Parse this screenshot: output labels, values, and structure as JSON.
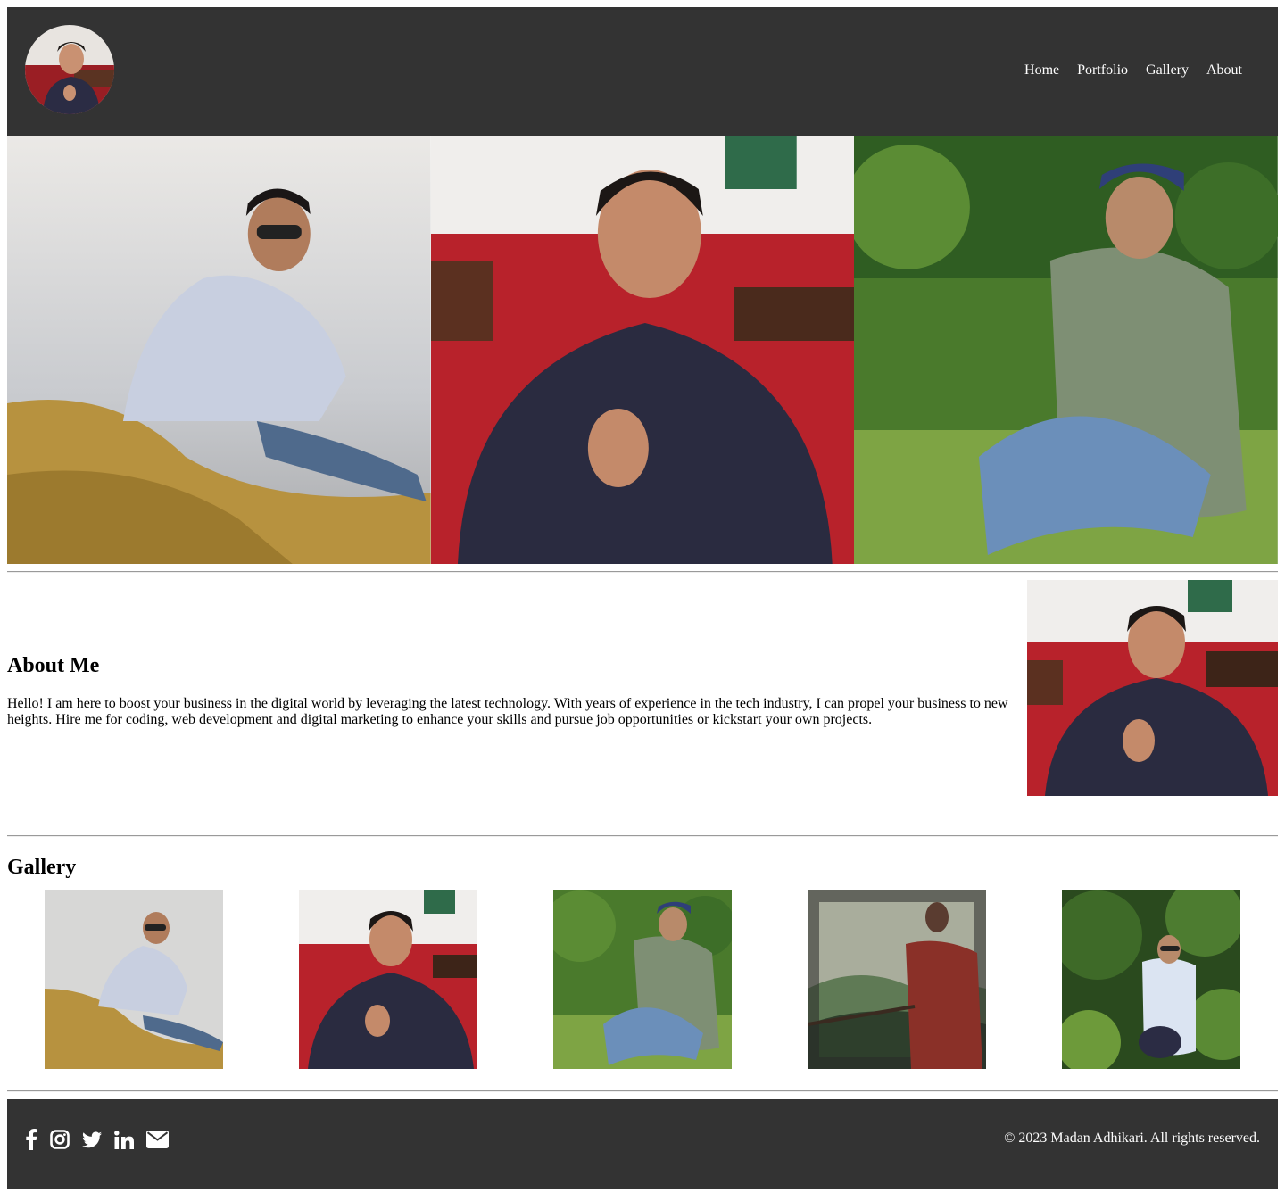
{
  "header": {
    "nav": [
      "Home",
      "Portfolio",
      "Gallery",
      "About"
    ]
  },
  "about": {
    "title": "About Me",
    "text": "Hello! I am here to boost your business in the digital world by leveraging the latest technology. With years of experience in the tech industry, I can propel your business to new heights. Hire me for coding, web development and digital marketing to enhance your skills and pursue job opportunities or kickstart your own projects."
  },
  "gallery": {
    "title": "Gallery"
  },
  "footer": {
    "social_icons": [
      "facebook-icon",
      "instagram-icon",
      "twitter-icon",
      "linkedin-icon",
      "envelope-icon"
    ],
    "copyright": "© 2023 Madan Adhikari. All rights reserved."
  },
  "colors": {
    "header_bg": "#333333",
    "footer_bg": "#333333",
    "nav_text": "#ffffff"
  }
}
